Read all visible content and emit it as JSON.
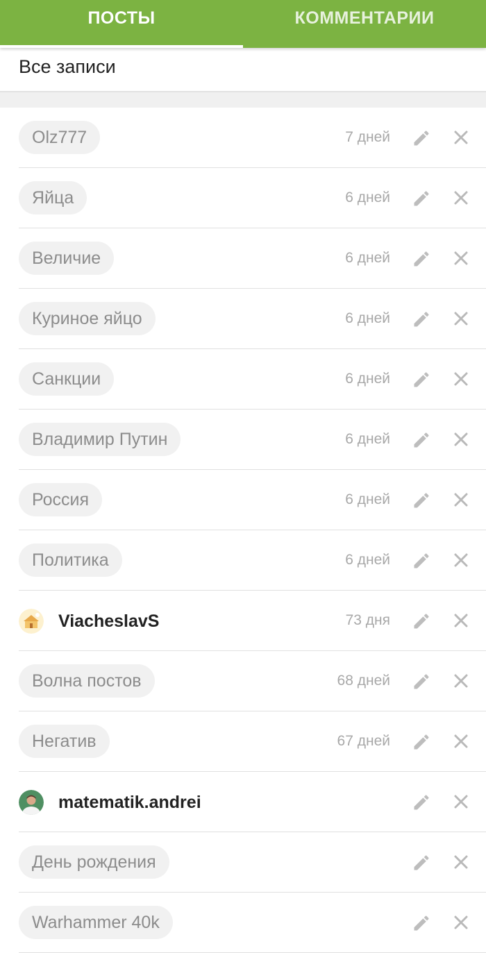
{
  "tabs": [
    {
      "label": "ПОСТЫ",
      "active": true
    },
    {
      "label": "КОММЕНТАРИИ",
      "active": false
    }
  ],
  "filter": {
    "label": "Все записи"
  },
  "colors": {
    "accent": "#7cb342",
    "chip_bg": "#f1f1f1",
    "muted_text": "#a8a8a8"
  },
  "items": [
    {
      "kind": "tag",
      "label": "Olz777",
      "age": "7 дней"
    },
    {
      "kind": "tag",
      "label": "Яйца",
      "age": "6 дней"
    },
    {
      "kind": "tag",
      "label": "Величие",
      "age": "6 дней"
    },
    {
      "kind": "tag",
      "label": "Куриное яйцо",
      "age": "6 дней"
    },
    {
      "kind": "tag",
      "label": "Санкции",
      "age": "6 дней"
    },
    {
      "kind": "tag",
      "label": "Владимир Путин",
      "age": "6 дней"
    },
    {
      "kind": "tag",
      "label": "Россия",
      "age": "6 дней"
    },
    {
      "kind": "tag",
      "label": "Политика",
      "age": "6 дней"
    },
    {
      "kind": "user",
      "label": "ViacheslavS",
      "age": "73 дня",
      "avatar": "yellow-house-avatar"
    },
    {
      "kind": "tag",
      "label": "Волна постов",
      "age": "68 дней"
    },
    {
      "kind": "tag",
      "label": "Негатив",
      "age": "67 дней"
    },
    {
      "kind": "user",
      "label": "matematik.andrei",
      "age": "",
      "avatar": "man-photo-avatar"
    },
    {
      "kind": "tag",
      "label": "День рождения",
      "age": ""
    },
    {
      "kind": "tag",
      "label": "Warhammer 40k",
      "age": ""
    }
  ],
  "icons": {
    "edit": "pencil-icon",
    "remove": "close-icon"
  }
}
